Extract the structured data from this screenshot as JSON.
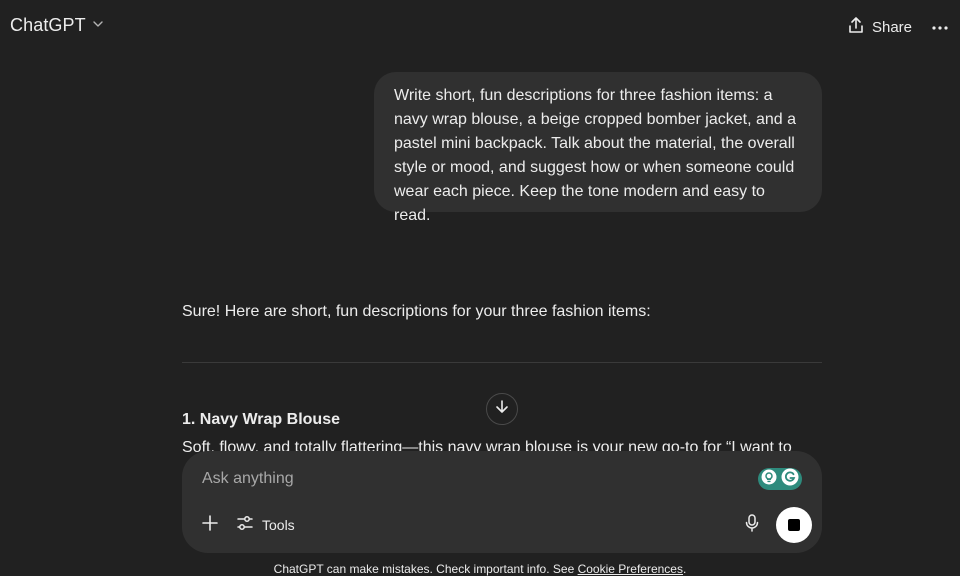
{
  "header": {
    "model_name": "ChatGPT",
    "share_label": "Share"
  },
  "conversation": {
    "user_message": "Write short, fun descriptions for three fashion items: a navy wrap blouse, a beige cropped bomber jacket, and a pastel mini backpack. Talk about the material, the overall style or mood, and suggest how or when someone could wear each piece. Keep the tone modern and easy to read.",
    "assistant_intro": "Sure! Here are short, fun descriptions for your three fashion items:",
    "item_1_heading": "1. Navy Wrap Blouse",
    "item_1_body": "Soft, flowy, and totally flattering—this navy wrap blouse is your new go-to for “I want to"
  },
  "composer": {
    "placeholder": "Ask anything",
    "tools_label": "Tools"
  },
  "footer": {
    "note_prefix": "ChatGPT can make mistakes. Check important info. See ",
    "link_label": "Cookie Preferences",
    "note_suffix": "."
  },
  "icons": {
    "model_dropdown": "chevron-down-icon",
    "share": "share-icon",
    "more": "more-horizontal-icon",
    "scroll": "arrow-down-icon",
    "plus": "plus-icon",
    "tools": "sliders-icon",
    "mic": "microphone-icon",
    "stop": "stop-icon",
    "grammarly": "grammarly-icon"
  },
  "colors": {
    "background": "#212121",
    "bubble": "#303030",
    "text": "#ececec",
    "grammarly": "#2e8b7d"
  }
}
